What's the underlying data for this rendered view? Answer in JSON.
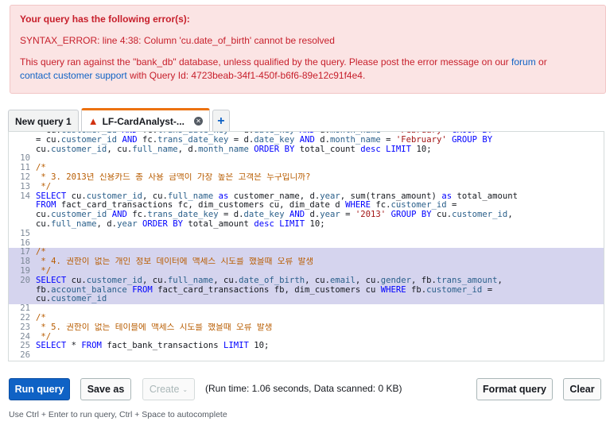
{
  "error": {
    "title": "Your query has the following error(s):",
    "message": "SYNTAX_ERROR: line 4:38: Column 'cu.date_of_birth' cannot be resolved",
    "info_prefix": "This query ran against the \"bank_db\" database, unless qualified by the query. Please post the error message on our ",
    "forum_link": "forum",
    "info_or": " or",
    "support_link": "contact customer support",
    "info_suffix": " with Query Id: 4723beab-34f1-450f-b6f6-89e12c91f4e4."
  },
  "tabs": [
    {
      "label": "New query 1"
    },
    {
      "label": "LF-CardAnalyst-...",
      "icon": "warning-icon",
      "close_icon": "close-icon"
    },
    {
      "label": "+"
    }
  ],
  "editor": {
    "lines": [
      {
        "n": "",
        "t": "= cu.customer_id AND fc.trans_date_key = d.date_key AND d.month_name = 'February' GROUP BY"
      },
      {
        "n": "",
        "t": "= cu.customer_id AND fc.trans_date_key = d.date_key AND d.month_name = 'February' GROUP BY"
      },
      {
        "n": "",
        "t": "cu.customer_id, cu.full_name, d.month_name ORDER BY total_count desc LIMIT 10;"
      },
      {
        "n": "10",
        "t": ""
      },
      {
        "n": "11",
        "t": "/*"
      },
      {
        "n": "12",
        "t": " * 3. 2013년 신용카드 총 사용 금액이 가장 높은 고객은 누구입니까?"
      },
      {
        "n": "13",
        "t": " */"
      },
      {
        "n": "14",
        "t": "SELECT cu.customer_id, cu.full_name as customer_name, d.year, sum(trans_amount) as total_amount"
      },
      {
        "n": "",
        "t": "FROM fact_card_transactions fc, dim_customers cu, dim_date d WHERE fc.customer_id ="
      },
      {
        "n": "",
        "t": "cu.customer_id AND fc.trans_date_key = d.date_key AND d.year = '2013' GROUP BY cu.customer_id,"
      },
      {
        "n": "",
        "t": "cu.full_name, d.year ORDER BY total_amount desc LIMIT 10;"
      },
      {
        "n": "15",
        "t": ""
      },
      {
        "n": "16",
        "t": ""
      },
      {
        "n": "17",
        "t": "/*"
      },
      {
        "n": "18",
        "t": " * 4. 권한이 없는 개인 정보 데이터에 액세스 시도를 했을때 오류 발생"
      },
      {
        "n": "19",
        "t": " */"
      },
      {
        "n": "20",
        "t": "SELECT cu.customer_id, cu.full_name, cu.date_of_birth, cu.email, cu.gender, fb.trans_amount,"
      },
      {
        "n": "",
        "t": "fb.account_balance FROM fact_card_transactions fb, dim_customers cu WHERE fb.customer_id ="
      },
      {
        "n": "",
        "t": "cu.customer_id"
      },
      {
        "n": "21",
        "t": ""
      },
      {
        "n": "22",
        "t": "/*"
      },
      {
        "n": "23",
        "t": " * 5. 권한이 없는 테이블에 액세스 시도를 했을때 오류 발생"
      },
      {
        "n": "24",
        "t": " */"
      },
      {
        "n": "25",
        "t": "SELECT * FROM fact_bank_transactions LIMIT 10;"
      },
      {
        "n": "26",
        "t": ""
      }
    ]
  },
  "toolbar": {
    "run_label": "Run query",
    "save_label": "Save as",
    "create_label": "Create",
    "runtime_text": "(Run time: 1.06 seconds, Data scanned: 0 KB)",
    "format_label": "Format query",
    "clear_label": "Clear"
  },
  "hint": "Use Ctrl + Enter to run query, Ctrl + Space to autocomplete"
}
